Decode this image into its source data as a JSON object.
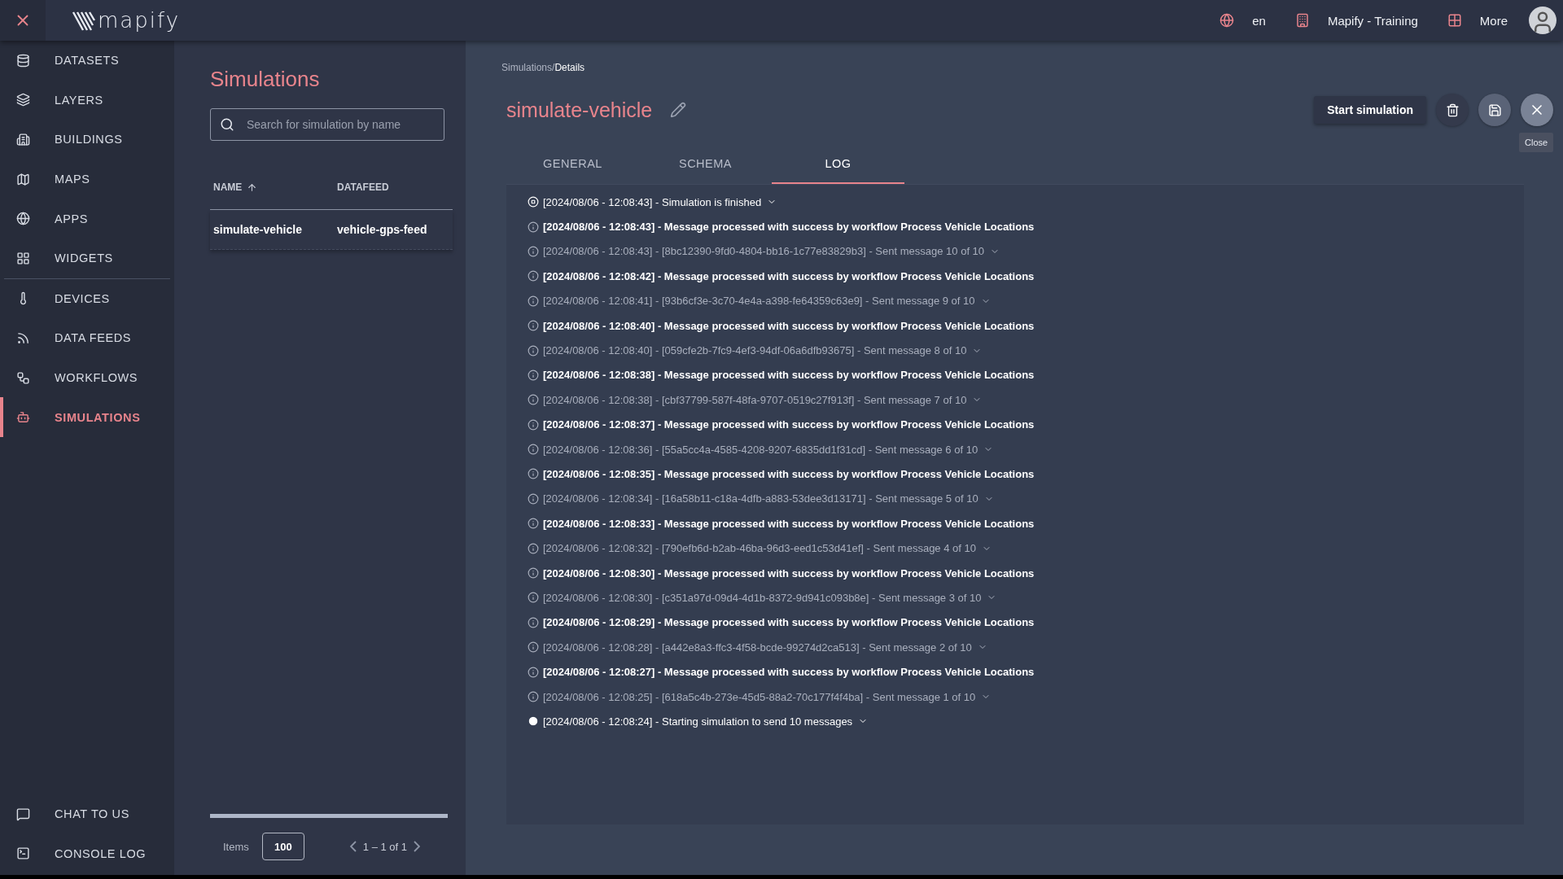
{
  "topbar": {
    "logo": "mapify",
    "language": "en",
    "organization": "Mapify - Training",
    "more": "More"
  },
  "sidebar": {
    "sections": [
      [
        {
          "label": "DATASETS",
          "selected": false
        },
        {
          "label": "LAYERS",
          "selected": false
        },
        {
          "label": "BUILDINGS",
          "selected": false
        },
        {
          "label": "MAPS",
          "selected": false
        },
        {
          "label": "APPS",
          "selected": false
        },
        {
          "label": "WIDGETS",
          "selected": false
        }
      ],
      [
        {
          "label": "DEVICES",
          "selected": false
        },
        {
          "label": "DATA FEEDS",
          "selected": false
        },
        {
          "label": "WORKFLOWS",
          "selected": false
        },
        {
          "label": "SIMULATIONS",
          "selected": true
        }
      ]
    ],
    "bottom_items": [
      {
        "label": "CHAT TO US"
      },
      {
        "label": "CONSOLE LOG"
      }
    ]
  },
  "list_panel": {
    "title": "Simulations",
    "search": {
      "placeholder": "Search for simulation by name"
    },
    "columns": [
      {
        "label": "NAME",
        "sorted": true
      },
      {
        "label": "DATAFEED",
        "sorted": false
      }
    ],
    "rows": [
      [
        "simulate-vehicle",
        "vehicle-gps-feed"
      ]
    ],
    "paginator": {
      "items_label": "Items",
      "page_size": "100",
      "range": "1 – 1 of 1"
    }
  },
  "details": {
    "breadcrumb": [
      "Simulations/",
      "Details"
    ],
    "title": "simulate-vehicle",
    "start_button": "Start simulation",
    "tooltip": "Close",
    "tabs": [
      {
        "label": "GENERAL",
        "selected": false
      },
      {
        "label": "SCHEMA",
        "selected": false
      },
      {
        "label": "LOG",
        "selected": true
      }
    ],
    "log": [
      {
        "kind": "finished",
        "text": "[2024/08/06 - 12:08:43] - Simulation is finished",
        "expandable": true
      },
      {
        "kind": "processed",
        "text": "[2024/08/06 - 12:08:43] - Message processed with success by workflow Process Vehicle Locations",
        "expandable": false
      },
      {
        "kind": "sent",
        "text": "[2024/08/06 - 12:08:43] - [8bc12390-9fd0-4804-bb16-1c77e83829b3] - Sent message 10 of 10",
        "expandable": true
      },
      {
        "kind": "processed",
        "text": "[2024/08/06 - 12:08:42] - Message processed with success by workflow Process Vehicle Locations",
        "expandable": false
      },
      {
        "kind": "sent",
        "text": "[2024/08/06 - 12:08:41] - [93b6cf3e-3c70-4e4a-a398-fe64359c63e9] - Sent message 9 of 10",
        "expandable": true
      },
      {
        "kind": "processed",
        "text": "[2024/08/06 - 12:08:40] - Message processed with success by workflow Process Vehicle Locations",
        "expandable": false
      },
      {
        "kind": "sent",
        "text": "[2024/08/06 - 12:08:40] - [059cfe2b-7fc9-4ef3-94df-06a6dfb93675] - Sent message 8 of 10",
        "expandable": true
      },
      {
        "kind": "processed",
        "text": "[2024/08/06 - 12:08:38] - Message processed with success by workflow Process Vehicle Locations",
        "expandable": false
      },
      {
        "kind": "sent",
        "text": "[2024/08/06 - 12:08:38] - [cbf37799-587f-48fa-9707-0519c27f913f] - Sent message 7 of 10",
        "expandable": true
      },
      {
        "kind": "processed",
        "text": "[2024/08/06 - 12:08:37] - Message processed with success by workflow Process Vehicle Locations",
        "expandable": false
      },
      {
        "kind": "sent",
        "text": "[2024/08/06 - 12:08:36] - [55a5cc4a-4585-4208-9207-6835dd1f31cd] - Sent message 6 of 10",
        "expandable": true
      },
      {
        "kind": "processed",
        "text": "[2024/08/06 - 12:08:35] - Message processed with success by workflow Process Vehicle Locations",
        "expandable": false
      },
      {
        "kind": "sent",
        "text": "[2024/08/06 - 12:08:34] - [16a58b11-c18a-4dfb-a883-53dee3d13171] - Sent message 5 of 10",
        "expandable": true
      },
      {
        "kind": "processed",
        "text": "[2024/08/06 - 12:08:33] - Message processed with success by workflow Process Vehicle Locations",
        "expandable": false
      },
      {
        "kind": "sent",
        "text": "[2024/08/06 - 12:08:32] - [790efb6d-b2ab-46ba-96d3-eed1c53d41ef] - Sent message 4 of 10",
        "expandable": true
      },
      {
        "kind": "processed",
        "text": "[2024/08/06 - 12:08:30] - Message processed with success by workflow Process Vehicle Locations",
        "expandable": false
      },
      {
        "kind": "sent",
        "text": "[2024/08/06 - 12:08:30] - [c351a97d-09d4-4d1b-8372-9d941c093b8e] - Sent message 3 of 10",
        "expandable": true
      },
      {
        "kind": "processed",
        "text": "[2024/08/06 - 12:08:29] - Message processed with success by workflow Process Vehicle Locations",
        "expandable": false
      },
      {
        "kind": "sent",
        "text": "[2024/08/06 - 12:08:28] - [a442e8a3-ffc3-4f58-bcde-99274d2ca513] - Sent message 2 of 10",
        "expandable": true
      },
      {
        "kind": "processed",
        "text": "[2024/08/06 - 12:08:27] - Message processed with success by workflow Process Vehicle Locations",
        "expandable": false
      },
      {
        "kind": "sent",
        "text": "[2024/08/06 - 12:08:25] - [618a5c4b-273e-45d5-88a2-70c177f4f4ba] - Sent message 1 of 10",
        "expandable": true
      },
      {
        "kind": "start",
        "text": "[2024/08/06 - 12:08:24] - Starting simulation to send 10 messages",
        "expandable": true
      }
    ]
  }
}
